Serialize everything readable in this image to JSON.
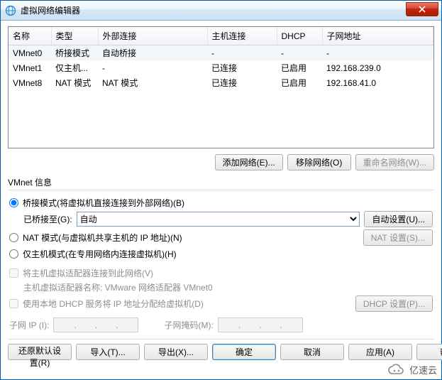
{
  "window": {
    "title": "虚拟网络编辑器"
  },
  "table": {
    "headers": [
      "名称",
      "类型",
      "外部连接",
      "主机连接",
      "DHCP",
      "子网地址"
    ],
    "rows": [
      {
        "name": "VMnet0",
        "type": "桥接模式",
        "ext": "自动桥接",
        "host": "-",
        "dhcp": "-",
        "subnet": "-",
        "selected": true
      },
      {
        "name": "VMnet1",
        "type": "仅主机...",
        "ext": "-",
        "host": "已连接",
        "dhcp": "已启用",
        "subnet": "192.168.239.0",
        "selected": false
      },
      {
        "name": "VMnet8",
        "type": "NAT 模式",
        "ext": "NAT 模式",
        "host": "已连接",
        "dhcp": "已启用",
        "subnet": "192.168.41.0",
        "selected": false
      }
    ]
  },
  "buttons": {
    "add_net": "添加网络(E)...",
    "remove_net": "移除网络(O)",
    "rename_net": "重命名网络(W)...",
    "auto_settings": "自动设置(U)...",
    "nat_settings": "NAT 设置(S)...",
    "dhcp_settings": "DHCP 设置(P)...",
    "restore": "还原默认设置(R)",
    "import": "导入(T)...",
    "export": "导出(X)...",
    "ok": "确定",
    "cancel": "取消",
    "apply": "应用(A)",
    "help": "帮助"
  },
  "vmnet_info": {
    "title": "VMnet 信息",
    "bridge_radio": "桥接模式(将虚拟机直接连接到外部网络)(B)",
    "bridge_to_label": "已桥接至(G):",
    "bridge_to_value": "自动",
    "nat_radio": "NAT 模式(与虚拟机共享主机的 IP 地址)(N)",
    "hostonly_radio": "仅主机模式(在专用网络内连接虚拟机)(H)",
    "connect_host_cb": "将主机虚拟适配器连接到此网络(V)",
    "adapter_name_label": "主机虚拟适配器名称: VMware 网络适配器 VMnet0",
    "dhcp_cb": "使用本地 DHCP 服务将 IP 地址分配给虚拟机(D)",
    "subnet_ip_label": "子网 IP (I):",
    "subnet_mask_label": "子网掩码(M):"
  },
  "badge": {
    "text": "亿速云"
  }
}
